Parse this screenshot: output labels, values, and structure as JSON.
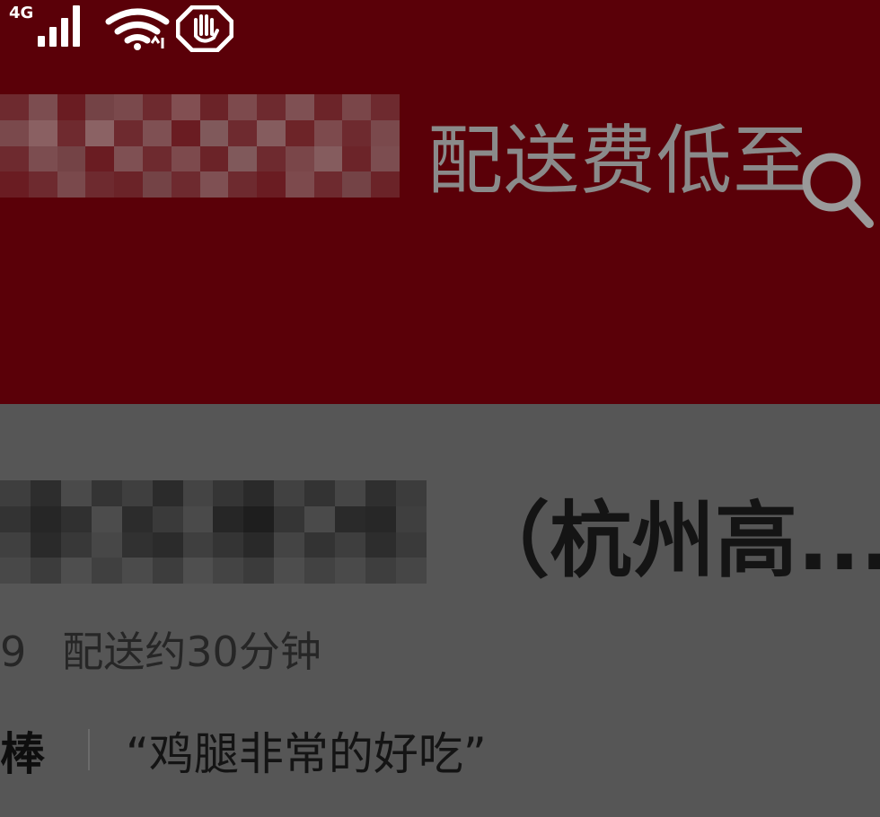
{
  "status_bar": {
    "network_label": "4G",
    "signal_icon": "cellular-signal-icon",
    "wifi_icon": "wifi-icon",
    "stop_icon": "hand-stop-icon"
  },
  "header": {
    "background_color": "#5a0008",
    "ad_text": "配送费低至",
    "search_icon": "search-icon"
  },
  "shop": {
    "name_suffix": "（杭州高...",
    "rating_fragment": "9",
    "delivery_time": "配送约30分钟",
    "review_tag": "棒",
    "review_quote": "“鸡腿非常的好吃”"
  }
}
